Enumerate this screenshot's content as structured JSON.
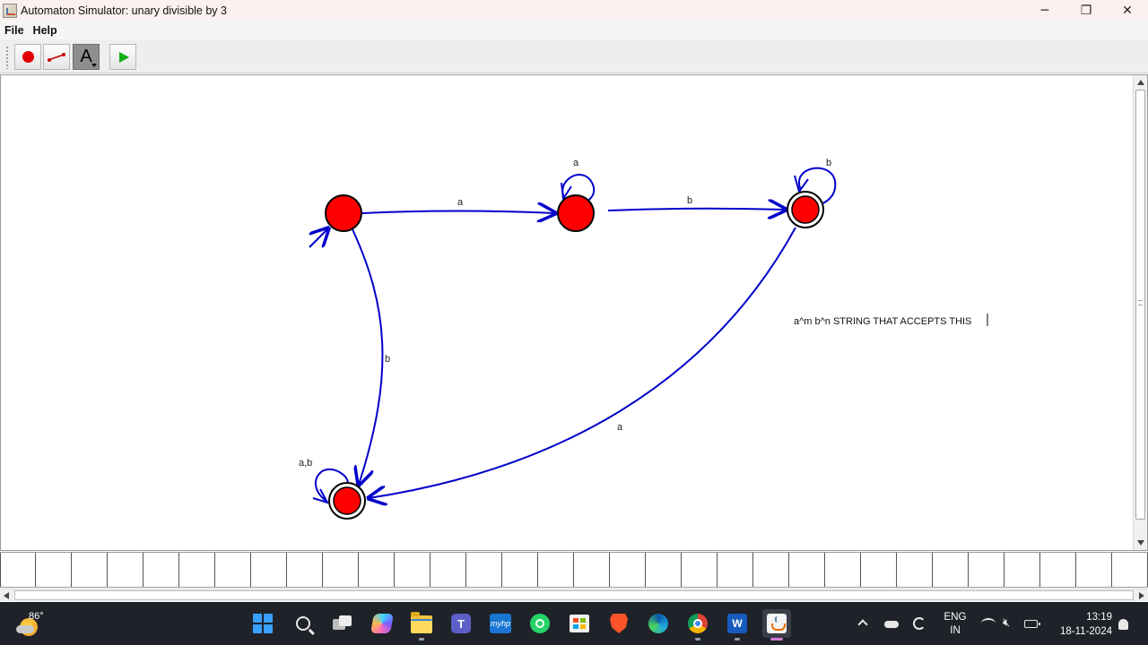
{
  "window": {
    "title": "Automaton Simulator: unary divisible by 3",
    "controls": {
      "minimize": "─",
      "maximize": "❐",
      "close": "✕"
    }
  },
  "menu": {
    "items": [
      "File",
      "Help"
    ]
  },
  "toolbar": {
    "tools": [
      {
        "name": "add-state-tool",
        "icon": "red-dot-icon"
      },
      {
        "name": "add-transition-tool",
        "icon": "arrow-line-icon"
      },
      {
        "name": "text-tool",
        "icon": "text-a-icon",
        "label": "A",
        "selected": true
      },
      {
        "name": "run-tool",
        "icon": "play-icon"
      }
    ]
  },
  "automaton": {
    "colors": {
      "state_fill": "#ff0000",
      "state_stroke": "#000000",
      "transition": "#0000cc"
    },
    "states": [
      {
        "id": "q0",
        "start": true,
        "accepting": false
      },
      {
        "id": "q1",
        "start": false,
        "accepting": false
      },
      {
        "id": "q2",
        "start": false,
        "accepting": true
      },
      {
        "id": "q3",
        "start": false,
        "accepting": true
      }
    ],
    "transitions": [
      {
        "from": "q0",
        "to": "q1",
        "label": "a"
      },
      {
        "from": "q1",
        "to": "q1",
        "label": "a"
      },
      {
        "from": "q1",
        "to": "q2",
        "label": "b"
      },
      {
        "from": "q2",
        "to": "q2",
        "label": "b"
      },
      {
        "from": "q0",
        "to": "q3",
        "label": "b"
      },
      {
        "from": "q2",
        "to": "q3",
        "label": "a"
      },
      {
        "from": "q3",
        "to": "q3",
        "label": "a,b"
      }
    ],
    "note": "a^m b^n STRING THAT ACCEPTS THIS"
  },
  "taskbar": {
    "weather": {
      "temperature": "86°",
      "icon": "partly-sunny-icon"
    },
    "apps": [
      {
        "name": "start",
        "icon": "windows-start-icon"
      },
      {
        "name": "search",
        "icon": "search-icon"
      },
      {
        "name": "task-view",
        "icon": "task-view-icon"
      },
      {
        "name": "copilot",
        "icon": "copilot-icon"
      },
      {
        "name": "file-explorer",
        "icon": "folder-icon",
        "running": true
      },
      {
        "name": "teams",
        "icon": "teams-icon",
        "label": "T"
      },
      {
        "name": "myhp",
        "icon": "hp-icon",
        "label": "myhp"
      },
      {
        "name": "whatsapp",
        "icon": "whatsapp-icon"
      },
      {
        "name": "microsoft-store",
        "icon": "store-icon"
      },
      {
        "name": "brave",
        "icon": "brave-icon"
      },
      {
        "name": "edge",
        "icon": "edge-icon"
      },
      {
        "name": "chrome",
        "icon": "chrome-icon",
        "running": true
      },
      {
        "name": "word",
        "icon": "word-icon",
        "label": "W",
        "running": true
      },
      {
        "name": "java",
        "icon": "java-icon",
        "running": true,
        "active": true
      }
    ],
    "tray": {
      "language_line1": "ENG",
      "language_line2": "IN",
      "time": "13:19",
      "date": "18-11-2024"
    }
  }
}
